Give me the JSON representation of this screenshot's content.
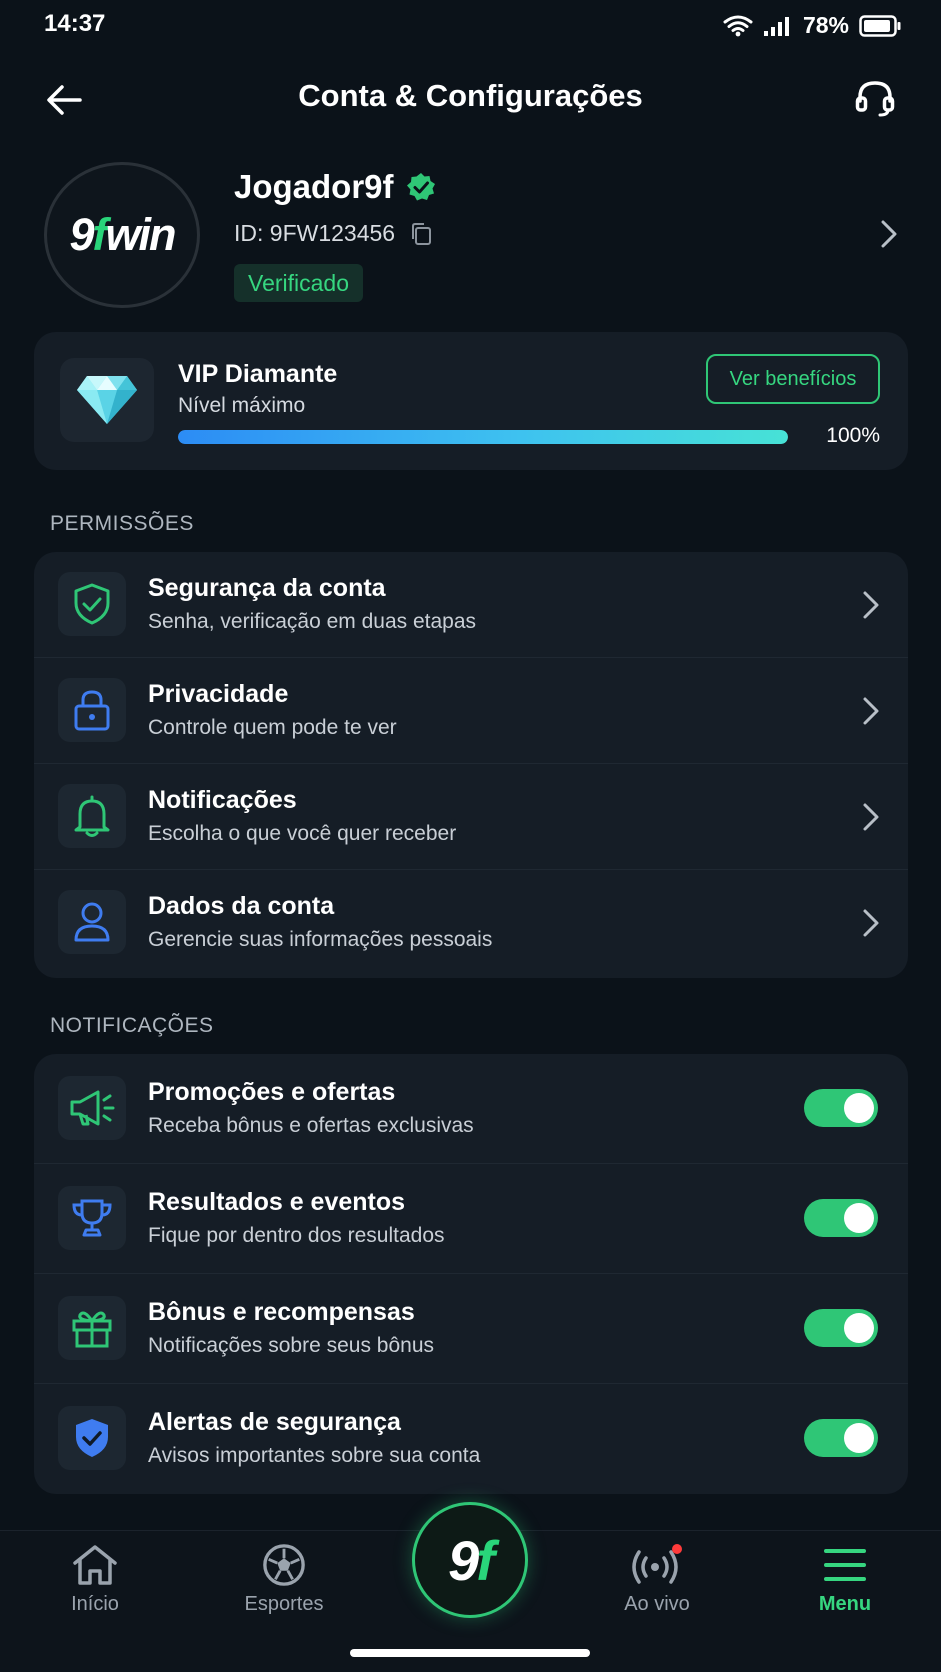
{
  "status_bar": {
    "time": "14:37",
    "battery": "78%"
  },
  "header": {
    "title": "Conta & Configurações"
  },
  "profile": {
    "logo_a": "9",
    "logo_b": "f",
    "logo_c": "win",
    "username": "Jogador9f",
    "id_text": "ID: 9FW123456",
    "verified_label": "Verificado"
  },
  "vip": {
    "title": "VIP Diamante",
    "subtitle": "Nível máximo",
    "benefits_label": "Ver benefícios",
    "progress": 1.0,
    "progress_label": "100%"
  },
  "permissions": {
    "label": "PERMISSÕES",
    "items": [
      {
        "title": "Segurança da conta",
        "subtitle": "Senha, verificação em duas etapas",
        "icon": "shield-check-icon"
      },
      {
        "title": "Privacidade",
        "subtitle": "Controle quem pode te ver",
        "icon": "lock-icon"
      },
      {
        "title": "Notificações",
        "subtitle": "Escolha o que você quer receber",
        "icon": "bell-icon"
      },
      {
        "title": "Dados da conta",
        "subtitle": "Gerencie suas informações pessoais",
        "icon": "user-icon"
      }
    ]
  },
  "notifications": {
    "label": "NOTIFICAÇÕES",
    "items": [
      {
        "title": "Promoções e ofertas",
        "subtitle": "Receba bônus e ofertas exclusivas",
        "icon": "megaphone-icon",
        "enabled": true
      },
      {
        "title": "Resultados e eventos",
        "subtitle": "Fique por dentro dos resultados",
        "icon": "trophy-icon",
        "enabled": true
      },
      {
        "title": "Bônus e recompensas",
        "subtitle": "Notificações sobre seus bônus",
        "icon": "gift-icon",
        "enabled": true
      },
      {
        "title": "Alertas de segurança",
        "subtitle": "Avisos importantes sobre sua conta",
        "icon": "shield-alert-icon",
        "enabled": true
      }
    ]
  },
  "bottom_nav": {
    "home": "Início",
    "sports": "Esportes",
    "center_a": "9",
    "center_b": "f",
    "live": "Ao vivo",
    "menu": "Menu"
  },
  "colors": {
    "accent": "#2fc676",
    "background": "#0b1219",
    "card": "#151d26",
    "blue_icon": "#3f7cf0"
  }
}
